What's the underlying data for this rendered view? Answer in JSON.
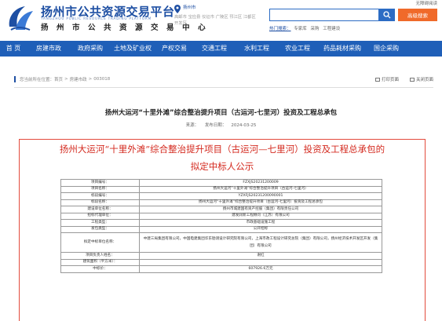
{
  "header": {
    "logo_title": "扬州市公共资源交易平台",
    "logo_en": "YANGZHOU PUBLIC RESOURCE TRADING PLATFORM",
    "logo_sub": "扬 州 市 公 共 资 源 交 易 中 心",
    "city_current": "扬州市",
    "city_list": "高邮市 宝应县 仪征市 广陵区 邗江区 江都区 开发区",
    "top_link": "无障碍阅读",
    "search": {
      "placeholder": "",
      "button_icon": "search-icon",
      "advanced_label": "高级搜索"
    },
    "hot": {
      "label": "热门搜索：",
      "items": [
        "专家库",
        "采购",
        "工程建设"
      ]
    }
  },
  "nav": {
    "items": [
      "首 页",
      "房建市政",
      "政府采购",
      "土地及矿业权",
      "产权交易",
      "交通工程",
      "水利工程",
      "农业工程",
      "药品耗材采购",
      "国企采购"
    ]
  },
  "breadcrumb": {
    "prefix": "您当前所在位置：",
    "items": [
      "首页",
      "房建市政",
      "003018"
    ],
    "actions": [
      "打印页面",
      "关闭页面"
    ]
  },
  "article": {
    "title": "扬州大运河“十里外滩”综合整治提升项目（古运河-七里河）投资及工程总承包",
    "source_label": "来源：",
    "date_label": "发布日期：",
    "date": "2024-03-25"
  },
  "notice": {
    "title_line1": "扬州大运河“十里外滩”综合整治提升项目（古运河—七里河）投资及工程总承包的",
    "title_line2": "拟定中标人公示",
    "rows": [
      {
        "k": "项目编号：",
        "v": "FZXJS20231200009"
      },
      {
        "k": "项目名称：",
        "v": "扬州大运河“十里外滩”综合整治提升项目（古运河-七里河）"
      },
      {
        "k": "标段编号：",
        "v": "YZXFJS20231200090001"
      },
      {
        "k": "标段名称：",
        "v": "扬州大运河“十里外滩”综合整治提升项目（古运河-七里河）投资及工程总承包"
      },
      {
        "k": "建设单位名称：",
        "v": "扬州市城建国有资产控股（集团）有限责任公司"
      },
      {
        "k": "招标代理单位：",
        "v": "建发润新工程顾问（江苏）有限公司"
      },
      {
        "k": "工程类型：",
        "v": "市政基础设施工程"
      },
      {
        "k": "发包类型：",
        "v": "公开招标"
      },
      {
        "k": "拟定中标单位名称：",
        "v": "中建三局集团有限公司，中国电建集团华东勘测设计研究院有限公司，上海市政工程设计研究总院（集团）有限公司，扬州经济技术开发区开发（集团）有限公司"
      },
      {
        "k": "项目负责人姓名：",
        "v": "谢红"
      },
      {
        "k": "建筑面积（平方米）：",
        "v": ""
      },
      {
        "k": "中标价：",
        "v": "607926.6万元"
      }
    ]
  }
}
